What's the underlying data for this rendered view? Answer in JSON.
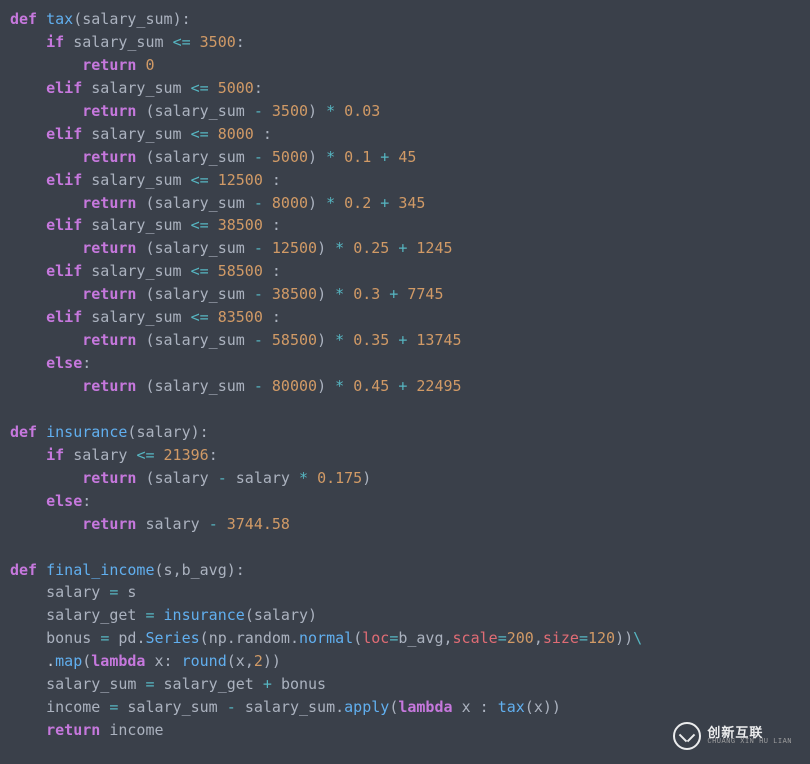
{
  "code_tokens": [
    [
      [
        "def",
        "kw"
      ],
      [
        " tax",
        "fn"
      ],
      [
        "(",
        "paren"
      ],
      [
        "salary_sum",
        "var"
      ],
      [
        "):",
        "paren"
      ]
    ],
    [
      [
        "    if ",
        "kw"
      ],
      [
        "salary_sum ",
        "var"
      ],
      [
        "<= ",
        "op"
      ],
      [
        "3500",
        "num"
      ],
      [
        ":",
        "pun"
      ]
    ],
    [
      [
        "        return ",
        "kw"
      ],
      [
        "0",
        "num"
      ]
    ],
    [
      [
        "    elif ",
        "kw"
      ],
      [
        "salary_sum ",
        "var"
      ],
      [
        "<= ",
        "op"
      ],
      [
        "5000",
        "num"
      ],
      [
        ":",
        "pun"
      ]
    ],
    [
      [
        "        return ",
        "kw"
      ],
      [
        "(",
        "paren"
      ],
      [
        "salary_sum ",
        "var"
      ],
      [
        "- ",
        "op"
      ],
      [
        "3500",
        "num"
      ],
      [
        ") ",
        "paren"
      ],
      [
        "* ",
        "op"
      ],
      [
        "0.03",
        "num"
      ]
    ],
    [
      [
        "    elif ",
        "kw"
      ],
      [
        "salary_sum ",
        "var"
      ],
      [
        "<= ",
        "op"
      ],
      [
        "8000",
        "num"
      ],
      [
        " :",
        "pun"
      ]
    ],
    [
      [
        "        return ",
        "kw"
      ],
      [
        "(",
        "paren"
      ],
      [
        "salary_sum ",
        "var"
      ],
      [
        "- ",
        "op"
      ],
      [
        "5000",
        "num"
      ],
      [
        ") ",
        "paren"
      ],
      [
        "* ",
        "op"
      ],
      [
        "0.1",
        "num"
      ],
      [
        " + ",
        "op"
      ],
      [
        "45",
        "num"
      ]
    ],
    [
      [
        "    elif ",
        "kw"
      ],
      [
        "salary_sum ",
        "var"
      ],
      [
        "<= ",
        "op"
      ],
      [
        "12500",
        "num"
      ],
      [
        " :",
        "pun"
      ]
    ],
    [
      [
        "        return ",
        "kw"
      ],
      [
        "(",
        "paren"
      ],
      [
        "salary_sum ",
        "var"
      ],
      [
        "- ",
        "op"
      ],
      [
        "8000",
        "num"
      ],
      [
        ") ",
        "paren"
      ],
      [
        "* ",
        "op"
      ],
      [
        "0.2",
        "num"
      ],
      [
        " + ",
        "op"
      ],
      [
        "345",
        "num"
      ]
    ],
    [
      [
        "    elif ",
        "kw"
      ],
      [
        "salary_sum ",
        "var"
      ],
      [
        "<= ",
        "op"
      ],
      [
        "38500",
        "num"
      ],
      [
        " :",
        "pun"
      ]
    ],
    [
      [
        "        return ",
        "kw"
      ],
      [
        "(",
        "paren"
      ],
      [
        "salary_sum ",
        "var"
      ],
      [
        "- ",
        "op"
      ],
      [
        "12500",
        "num"
      ],
      [
        ") ",
        "paren"
      ],
      [
        "* ",
        "op"
      ],
      [
        "0.25",
        "num"
      ],
      [
        " + ",
        "op"
      ],
      [
        "1245",
        "num"
      ]
    ],
    [
      [
        "    elif ",
        "kw"
      ],
      [
        "salary_sum ",
        "var"
      ],
      [
        "<= ",
        "op"
      ],
      [
        "58500",
        "num"
      ],
      [
        " :",
        "pun"
      ]
    ],
    [
      [
        "        return ",
        "kw"
      ],
      [
        "(",
        "paren"
      ],
      [
        "salary_sum ",
        "var"
      ],
      [
        "- ",
        "op"
      ],
      [
        "38500",
        "num"
      ],
      [
        ") ",
        "paren"
      ],
      [
        "* ",
        "op"
      ],
      [
        "0.3",
        "num"
      ],
      [
        " + ",
        "op"
      ],
      [
        "7745",
        "num"
      ]
    ],
    [
      [
        "    elif ",
        "kw"
      ],
      [
        "salary_sum ",
        "var"
      ],
      [
        "<= ",
        "op"
      ],
      [
        "83500",
        "num"
      ],
      [
        " :",
        "pun"
      ]
    ],
    [
      [
        "        return ",
        "kw"
      ],
      [
        "(",
        "paren"
      ],
      [
        "salary_sum ",
        "var"
      ],
      [
        "- ",
        "op"
      ],
      [
        "58500",
        "num"
      ],
      [
        ") ",
        "paren"
      ],
      [
        "* ",
        "op"
      ],
      [
        "0.35",
        "num"
      ],
      [
        " + ",
        "op"
      ],
      [
        "13745",
        "num"
      ]
    ],
    [
      [
        "    else",
        "kw"
      ],
      [
        ":",
        "pun"
      ]
    ],
    [
      [
        "        return ",
        "kw"
      ],
      [
        "(",
        "paren"
      ],
      [
        "salary_sum ",
        "var"
      ],
      [
        "- ",
        "op"
      ],
      [
        "80000",
        "num"
      ],
      [
        ") ",
        "paren"
      ],
      [
        "* ",
        "op"
      ],
      [
        "0.45",
        "num"
      ],
      [
        " + ",
        "op"
      ],
      [
        "22495",
        "num"
      ]
    ],
    [
      [
        "",
        ""
      ]
    ],
    [
      [
        "def",
        "kw"
      ],
      [
        " insurance",
        "fn"
      ],
      [
        "(",
        "paren"
      ],
      [
        "salary",
        "var"
      ],
      [
        "):",
        "paren"
      ]
    ],
    [
      [
        "    if ",
        "kw"
      ],
      [
        "salary ",
        "var"
      ],
      [
        "<= ",
        "op"
      ],
      [
        "21396",
        "num"
      ],
      [
        ":",
        "pun"
      ]
    ],
    [
      [
        "        return ",
        "kw"
      ],
      [
        "(",
        "paren"
      ],
      [
        "salary ",
        "var"
      ],
      [
        "- ",
        "op"
      ],
      [
        "salary ",
        "var"
      ],
      [
        "* ",
        "op"
      ],
      [
        "0.175",
        "num"
      ],
      [
        ")",
        "paren"
      ]
    ],
    [
      [
        "    else",
        "kw"
      ],
      [
        ":",
        "pun"
      ]
    ],
    [
      [
        "        return ",
        "kw"
      ],
      [
        "salary ",
        "var"
      ],
      [
        "- ",
        "op"
      ],
      [
        "3744.58",
        "num"
      ]
    ],
    [
      [
        "",
        ""
      ]
    ],
    [
      [
        "def",
        "kw"
      ],
      [
        " final_income",
        "fn"
      ],
      [
        "(",
        "paren"
      ],
      [
        "s",
        "var"
      ],
      [
        ",",
        "pun"
      ],
      [
        "b_avg",
        "var"
      ],
      [
        "):",
        "paren"
      ]
    ],
    [
      [
        "    ",
        ""
      ],
      [
        "salary ",
        "var"
      ],
      [
        "= ",
        "op"
      ],
      [
        "s",
        "var"
      ]
    ],
    [
      [
        "    ",
        ""
      ],
      [
        "salary_get ",
        "var"
      ],
      [
        "= ",
        "op"
      ],
      [
        "insurance",
        "fn"
      ],
      [
        "(",
        "paren"
      ],
      [
        "salary",
        "var"
      ],
      [
        ")",
        "paren"
      ]
    ],
    [
      [
        "    ",
        ""
      ],
      [
        "bonus ",
        "var"
      ],
      [
        "= ",
        "op"
      ],
      [
        "pd",
        "var"
      ],
      [
        ".",
        "pun"
      ],
      [
        "Series",
        "fn"
      ],
      [
        "(",
        "paren"
      ],
      [
        "np",
        "var"
      ],
      [
        ".",
        "pun"
      ],
      [
        "random",
        "var"
      ],
      [
        ".",
        "pun"
      ],
      [
        "normal",
        "fn"
      ],
      [
        "(",
        "paren"
      ],
      [
        "loc",
        "attr"
      ],
      [
        "=",
        "op"
      ],
      [
        "b_avg",
        "var"
      ],
      [
        ",",
        "pun"
      ],
      [
        "scale",
        "attr"
      ],
      [
        "=",
        "op"
      ],
      [
        "200",
        "num"
      ],
      [
        ",",
        "pun"
      ],
      [
        "size",
        "attr"
      ],
      [
        "=",
        "op"
      ],
      [
        "120",
        "num"
      ],
      [
        "))",
        "paren"
      ],
      [
        "\\",
        "op"
      ]
    ],
    [
      [
        "    .",
        ""
      ],
      [
        "map",
        "fn"
      ],
      [
        "(",
        "paren"
      ],
      [
        "lambda ",
        "kw"
      ],
      [
        "x",
        "var"
      ],
      [
        ": ",
        "pun"
      ],
      [
        "round",
        "fn"
      ],
      [
        "(",
        "paren"
      ],
      [
        "x",
        "var"
      ],
      [
        ",",
        "pun"
      ],
      [
        "2",
        "num"
      ],
      [
        "))",
        "paren"
      ]
    ],
    [
      [
        "    ",
        ""
      ],
      [
        "salary_sum ",
        "var"
      ],
      [
        "= ",
        "op"
      ],
      [
        "salary_get ",
        "var"
      ],
      [
        "+ ",
        "op"
      ],
      [
        "bonus",
        "var"
      ]
    ],
    [
      [
        "    ",
        ""
      ],
      [
        "income ",
        "var"
      ],
      [
        "= ",
        "op"
      ],
      [
        "salary_sum ",
        "var"
      ],
      [
        "- ",
        "op"
      ],
      [
        "salary_sum",
        "var"
      ],
      [
        ".",
        "pun"
      ],
      [
        "apply",
        "fn"
      ],
      [
        "(",
        "paren"
      ],
      [
        "lambda ",
        "kw"
      ],
      [
        "x ",
        "var"
      ],
      [
        ": ",
        "pun"
      ],
      [
        "tax",
        "fn"
      ],
      [
        "(",
        "paren"
      ],
      [
        "x",
        "var"
      ],
      [
        "))",
        "paren"
      ]
    ],
    [
      [
        "    return ",
        "kw"
      ],
      [
        "income",
        "var"
      ]
    ]
  ],
  "watermark": {
    "cn": "创新互联",
    "en": "CHUANG XIN HU LIAN"
  }
}
